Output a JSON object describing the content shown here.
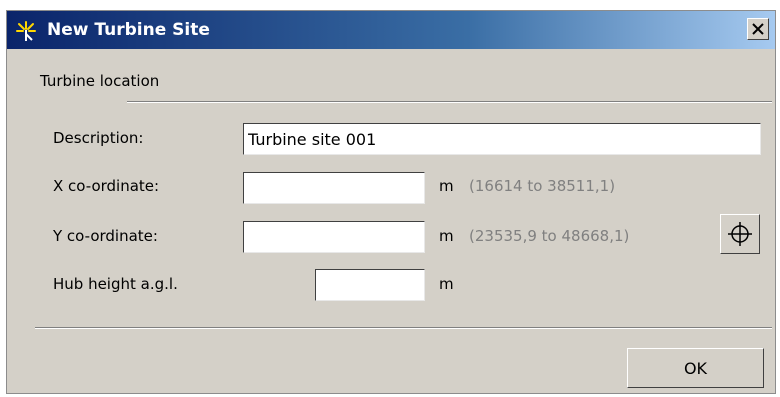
{
  "window": {
    "title": "New Turbine Site",
    "close_label": "X",
    "icon": "turbine-spark-icon"
  },
  "section": {
    "title": "Turbine location"
  },
  "fields": {
    "description": {
      "label": "Description:",
      "value": "Turbine site 001"
    },
    "x": {
      "label": "X co-ordinate:",
      "value": "",
      "unit": "m",
      "range": "(16614 to 38511,1)"
    },
    "y": {
      "label": "Y co-ordinate:",
      "value": "",
      "unit": "m",
      "range": "(23535,9 to 48668,1)"
    },
    "hub": {
      "label": "Hub height a.g.l.",
      "value": "",
      "unit": "m"
    }
  },
  "buttons": {
    "pick_location_icon": "crosshair-icon",
    "ok_label": "OK"
  },
  "colors": {
    "titlebar_start": "#0a246a",
    "titlebar_end": "#a6caf0",
    "dialog_bg": "#d4d0c8",
    "hint_text": "#808080"
  }
}
